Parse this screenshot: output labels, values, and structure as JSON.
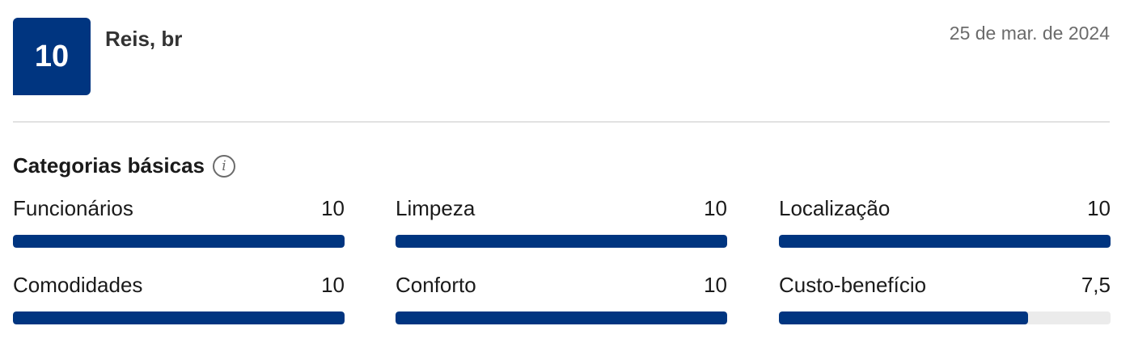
{
  "review": {
    "score": "10",
    "reviewer": "Reis, br",
    "date": "25 de mar. de 2024"
  },
  "categories_section": {
    "title": "Categorias básicas",
    "info_icon": "info-icon",
    "items": [
      {
        "label": "Funcionários",
        "value": "10",
        "fraction": 1.0
      },
      {
        "label": "Limpeza",
        "value": "10",
        "fraction": 1.0
      },
      {
        "label": "Localização",
        "value": "10",
        "fraction": 1.0
      },
      {
        "label": "Comodidades",
        "value": "10",
        "fraction": 1.0
      },
      {
        "label": "Conforto",
        "value": "10",
        "fraction": 1.0
      },
      {
        "label": "Custo-benefício",
        "value": "7,5",
        "fraction": 0.75
      }
    ]
  },
  "colors": {
    "brand_blue": "#003580",
    "track_gray": "#ebebeb"
  }
}
